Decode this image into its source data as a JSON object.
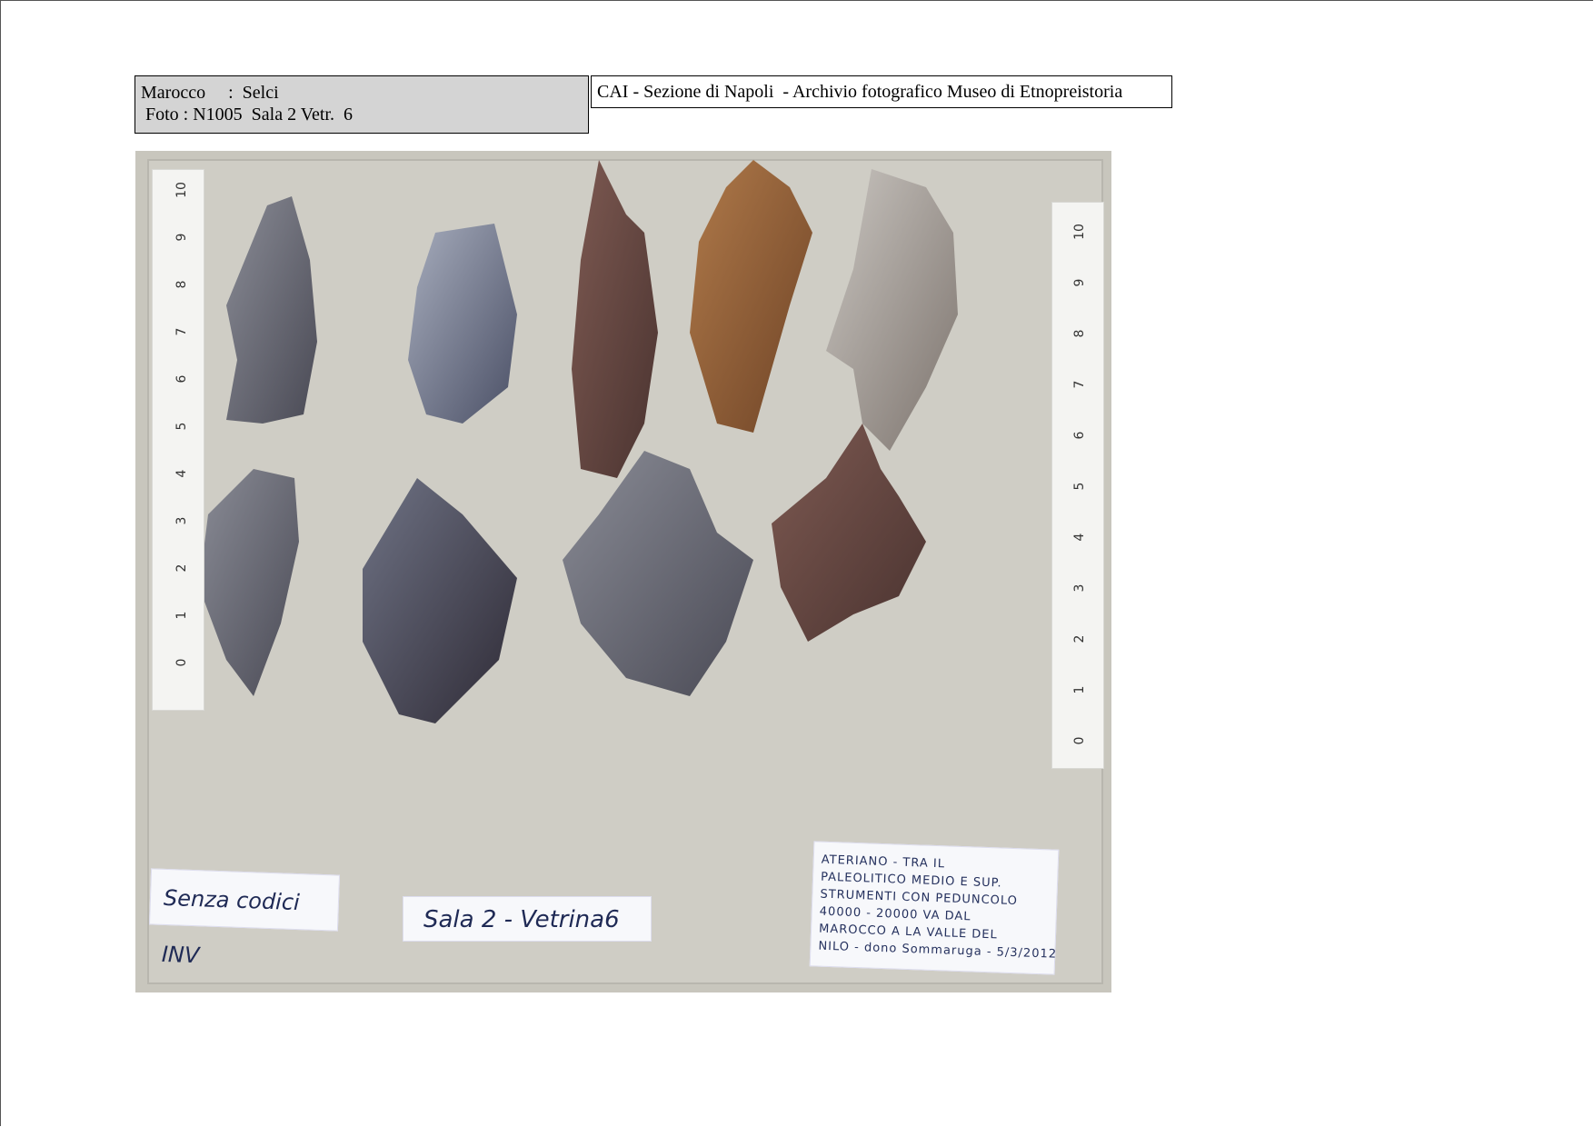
{
  "caption": {
    "line1": "Marocco     :  Selci",
    "line2": "Foto : N1005  Sala 2 Vetr.  6"
  },
  "archive_header": "CAI - Sezione di Napoli  - Archivio fotografico Museo di Etnopreistoria",
  "photo": {
    "ruler_left_ticks": [
      "10",
      "9",
      "8",
      "7",
      "6",
      "5",
      "4",
      "3",
      "2",
      "1",
      "0"
    ],
    "ruler_right_ticks": [
      "10",
      "9",
      "8",
      "7",
      "6",
      "5",
      "4",
      "3",
      "2",
      "1",
      "0"
    ],
    "label_inventory": "Senza codici INV",
    "label_room": "Sala 2 - Vetrina6",
    "museum_note": [
      "ATERIANO - TRA IL",
      "PALEOLITICO MEDIO E SUP.",
      "STRUMENTI CON PEDUNCOLO",
      "40000 - 20000 VA DAL",
      "MAROCCO A LA VALLE DEL",
      "NILO - dono Sommaruga - 5/3/2012"
    ],
    "colors": {
      "board": "#c8c6bd",
      "flint_grey": "#6a6a74",
      "flint_brown": "#6b4a42",
      "flint_orange": "#8c5a36"
    }
  }
}
